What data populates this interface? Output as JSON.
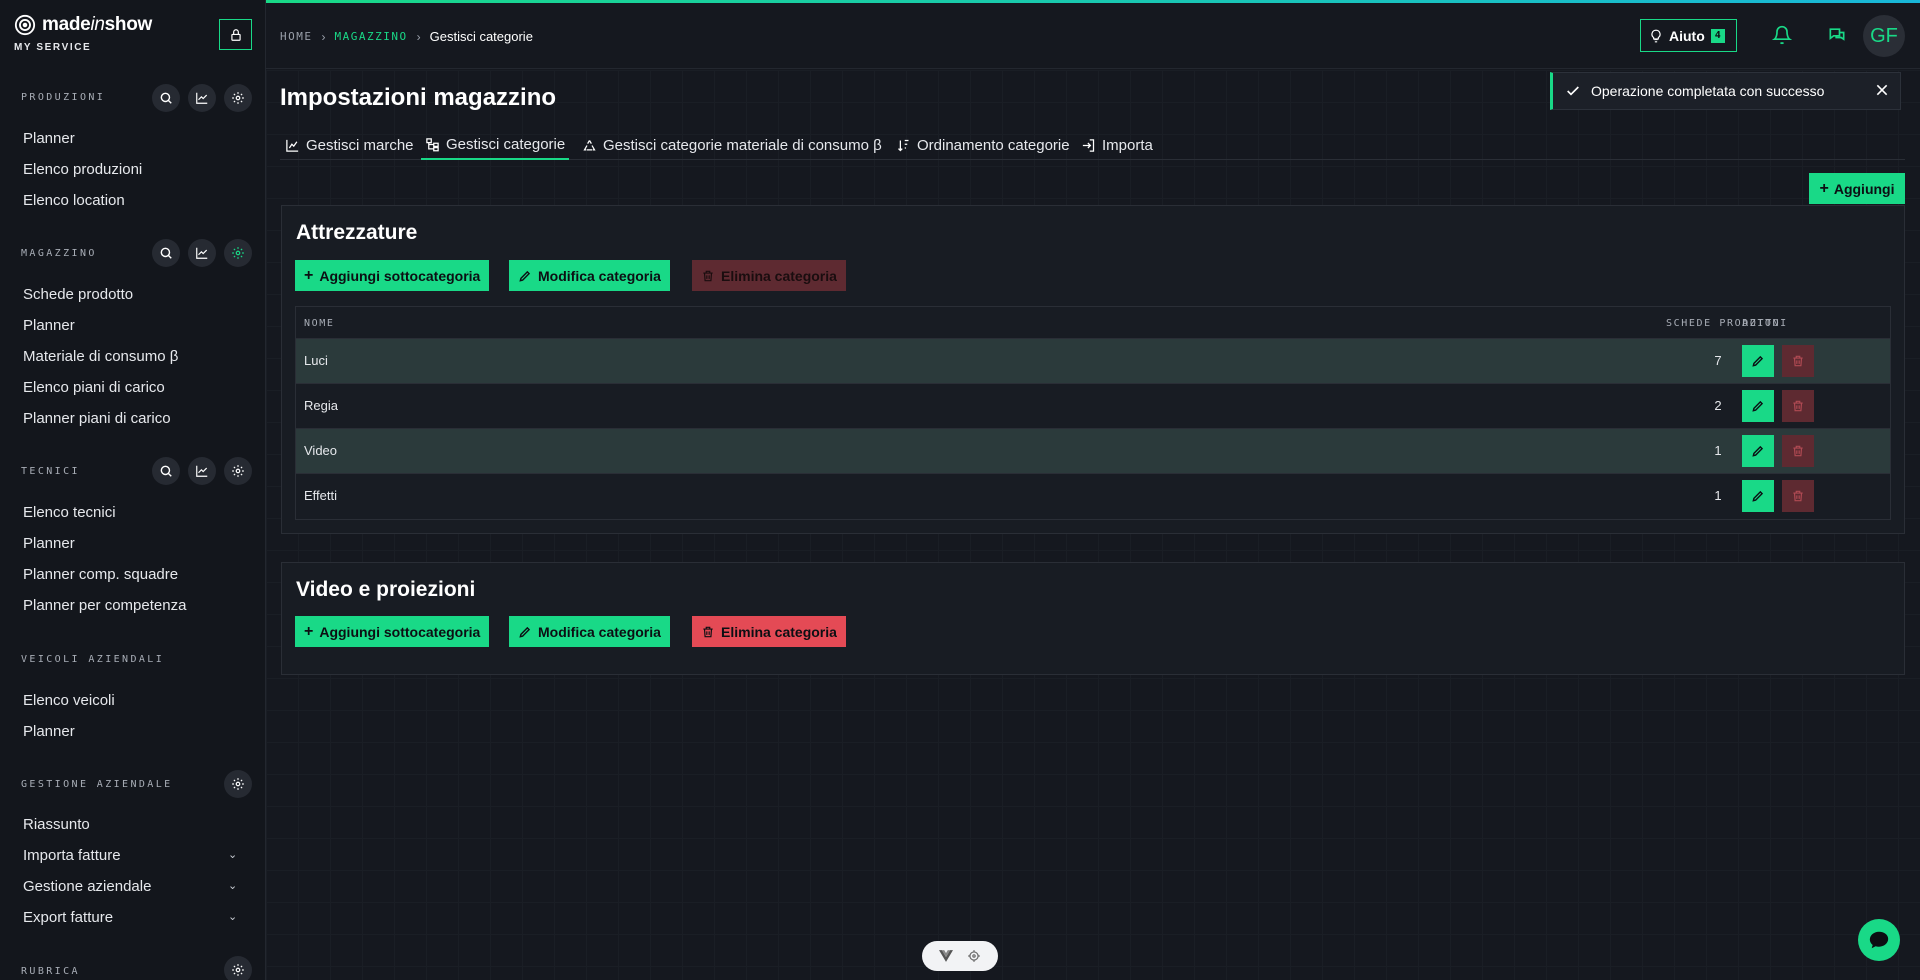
{
  "brand": {
    "name_main": "made",
    "name_italic": "in",
    "name_end": "show",
    "subtitle": "MY SERVICE"
  },
  "sidebar": {
    "sections": [
      {
        "title": "PRODUZIONI",
        "items": [
          "Planner",
          "Elenco produzioni",
          "Elenco location"
        ]
      },
      {
        "title": "MAGAZZINO",
        "items": [
          "Schede prodotto",
          "Planner",
          "Materiale di consumo β",
          "Elenco piani di carico",
          "Planner piani di carico"
        ]
      },
      {
        "title": "TECNICI",
        "items": [
          "Elenco tecnici",
          "Planner",
          "Planner comp. squadre",
          "Planner per competenza"
        ]
      },
      {
        "title": "VEICOLI AZIENDALI",
        "items": [
          "Elenco veicoli",
          "Planner"
        ]
      },
      {
        "title": "GESTIONE AZIENDALE",
        "items": [
          "Riassunto",
          "Importa fatture",
          "Gestione aziendale",
          "Export fatture"
        ]
      },
      {
        "title": "RUBRICA",
        "items": []
      }
    ]
  },
  "breadcrumb": {
    "home": "HOME",
    "magazzino": "MAGAZZINO",
    "current": "Gestisci categorie"
  },
  "topbar": {
    "help_label": "Aiuto",
    "help_count": "4",
    "avatar_initials": "GF"
  },
  "page": {
    "title": "Impostazioni magazzino",
    "tabs": [
      "Gestisci marche",
      "Gestisci categorie",
      "Gestisci categorie materiale di consumo β",
      "Ordinamento categorie",
      "Importa"
    ],
    "add_label": "Aggiungi"
  },
  "toast": {
    "message": "Operazione completata con successo"
  },
  "categories": [
    {
      "title": "Attrezzature",
      "add_sub": "Aggiungi sottocategoria",
      "edit": "Modifica categoria",
      "delete": "Elimina categoria",
      "table": {
        "headers": {
          "name": "NOME",
          "count": "SCHEDE PRODOTTO",
          "actions": "AZIONI"
        },
        "rows": [
          {
            "name": "Luci",
            "count": "7"
          },
          {
            "name": "Regia",
            "count": "2"
          },
          {
            "name": "Video",
            "count": "1"
          },
          {
            "name": "Effetti",
            "count": "1"
          }
        ]
      }
    },
    {
      "title": "Video e proiezioni",
      "add_sub": "Aggiungi sottocategoria",
      "edit": "Modifica categoria",
      "delete": "Elimina categoria"
    }
  ],
  "colors": {
    "accent": "#19d987",
    "danger": "#e44a55",
    "danger_disabled": "#5e2a31",
    "background": "#15181f"
  }
}
